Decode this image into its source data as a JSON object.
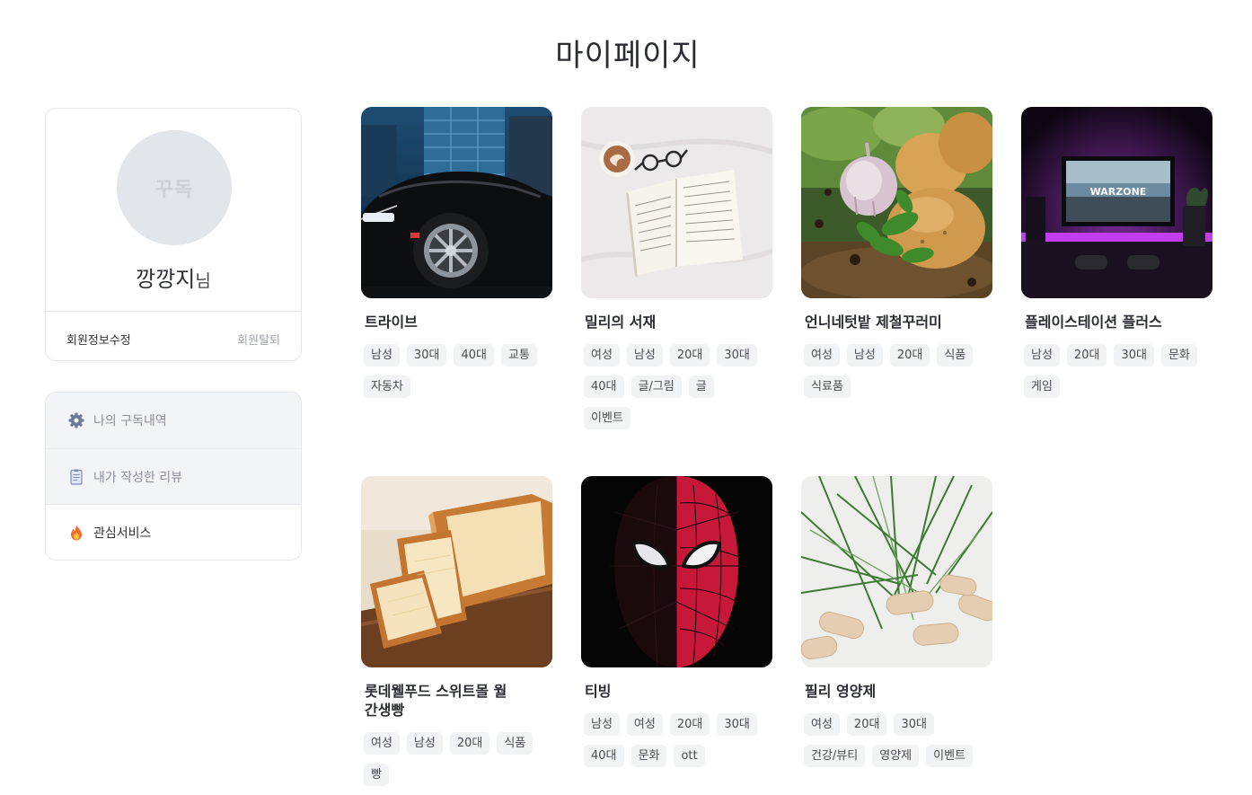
{
  "page": {
    "title": "마이페이지"
  },
  "profile": {
    "avatar_text": "꾸독",
    "name": "깡깡지",
    "name_suffix": "님",
    "edit_label": "회원정보수정",
    "leave_label": "회원탈퇴"
  },
  "menu": {
    "items": [
      {
        "label": "나의 구독내역",
        "icon": "gear-icon"
      },
      {
        "label": "내가 작성한 리뷰",
        "icon": "document-icon"
      },
      {
        "label": "관심서비스",
        "icon": "fire-icon"
      }
    ]
  },
  "services": [
    {
      "title": "트라이브",
      "tags": [
        "남성",
        "30대",
        "40대",
        "교통",
        "자동차"
      ],
      "image": "black-car"
    },
    {
      "title": "밀리의 서재",
      "tags": [
        "여성",
        "남성",
        "20대",
        "30대",
        "40대",
        "글/그림",
        "글",
        "이벤트"
      ],
      "image": "open-book-coffee"
    },
    {
      "title": "언니네텃밭 제철꾸러미",
      "tags": [
        "여성",
        "남성",
        "20대",
        "식품",
        "식료품"
      ],
      "image": "vegetables"
    },
    {
      "title": "플레이스테이션 플러스",
      "tags": [
        "남성",
        "20대",
        "30대",
        "문화",
        "게임"
      ],
      "image": "gaming-tv"
    },
    {
      "title": "롯데웰푸드 스위트몰 월간생빵",
      "tags": [
        "여성",
        "남성",
        "20대",
        "식품",
        "빵"
      ],
      "image": "bread"
    },
    {
      "title": "티빙",
      "tags": [
        "남성",
        "여성",
        "20대",
        "30대",
        "40대",
        "문화",
        "ott"
      ],
      "image": "spider-man"
    },
    {
      "title": "필리 영양제",
      "tags": [
        "여성",
        "20대",
        "30대",
        "건강/뷰티",
        "영양제",
        "이벤트"
      ],
      "image": "supplement-capsules"
    }
  ]
}
